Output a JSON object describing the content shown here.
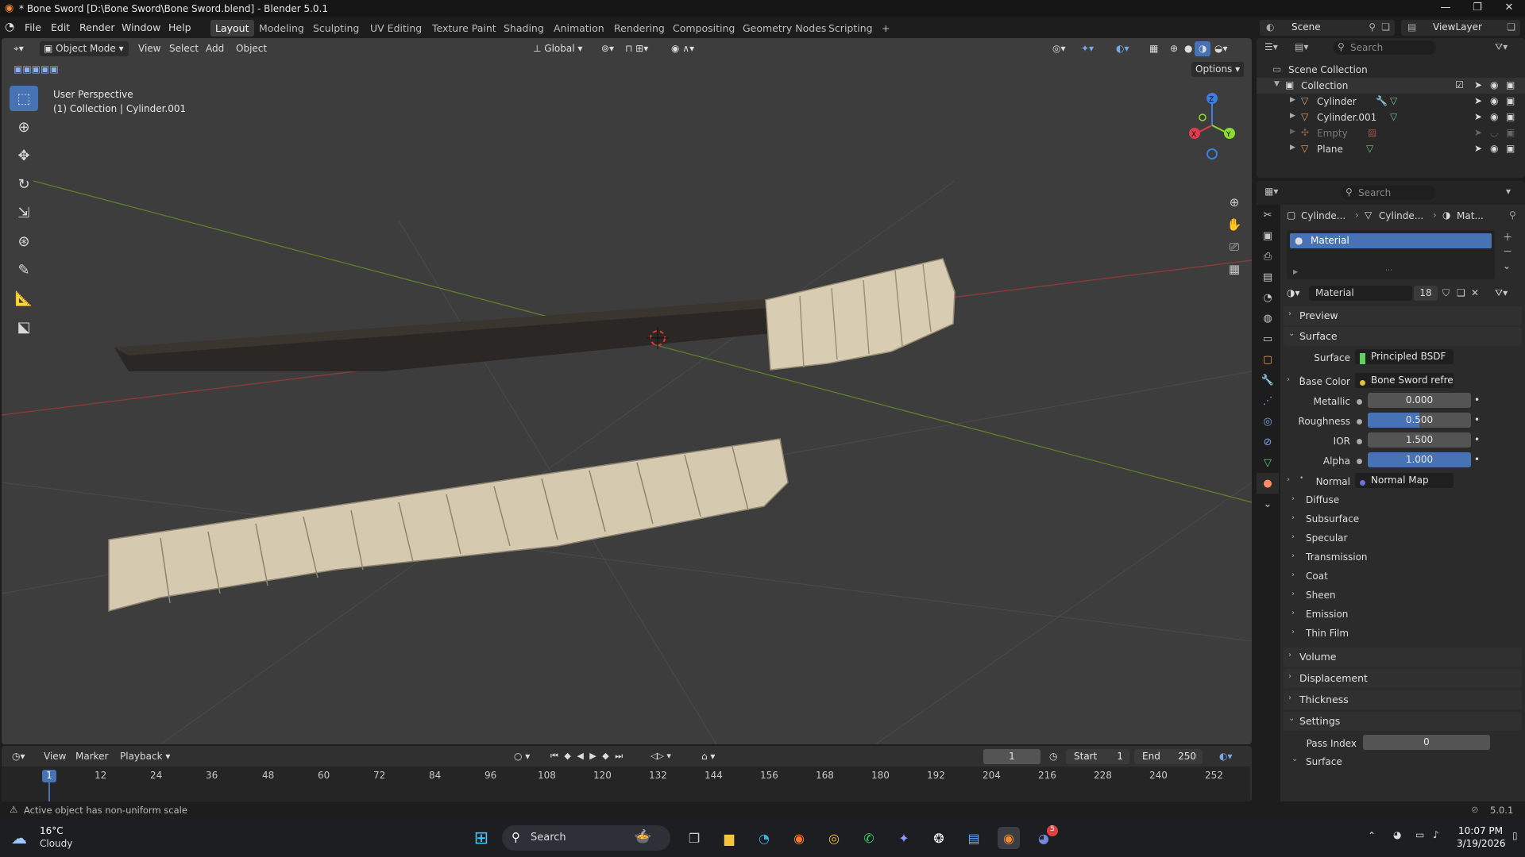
{
  "window": {
    "title": "* Bone Sword [D:\\Bone Sword\\Bone Sword.blend] - Blender 5.0.1",
    "minimize": "—",
    "maximize": "❐",
    "close": "✕"
  },
  "menubar": {
    "items": [
      "File",
      "Edit",
      "Render",
      "Window",
      "Help"
    ]
  },
  "workspaces": [
    "Layout",
    "Modeling",
    "Sculpting",
    "UV Editing",
    "Texture Paint",
    "Shading",
    "Animation",
    "Rendering",
    "Compositing",
    "Geometry Nodes",
    "Scripting"
  ],
  "active_workspace": "Layout",
  "add_workspace": "+",
  "scene": {
    "name": "Scene",
    "view_layer": "ViewLayer"
  },
  "viewport": {
    "mode": "Object Mode",
    "menus": [
      "View",
      "Select",
      "Add",
      "Object"
    ],
    "transform_orientation": "Global",
    "options_label": "Options",
    "perspective_label": "User Perspective",
    "collection_label": "(1) Collection | Cylinder.001",
    "gizmo_axes": [
      "Z",
      "Y",
      "X"
    ]
  },
  "outliner": {
    "search_placeholder": "Search",
    "root": "Scene Collection",
    "collection": "Collection",
    "objects": [
      {
        "name": "Cylinder"
      },
      {
        "name": "Cylinder.001"
      },
      {
        "name": "Empty"
      },
      {
        "name": "Plane"
      }
    ]
  },
  "properties": {
    "search_placeholder": "Search",
    "breadcrumb": [
      "Cylinde...",
      "Cylinde...",
      "Mat..."
    ],
    "material_slot": "Material",
    "material_name": "Material",
    "material_users": "18",
    "panels": {
      "preview": "Preview",
      "surface": "Surface",
      "surface_label": "Surface",
      "surface_value": "Principled BSDF",
      "base_color_label": "Base Color",
      "base_color_value": "Bone Sword refrence_...",
      "metallic_label": "Metallic",
      "metallic_value": "0.000",
      "roughness_label": "Roughness",
      "roughness_value": "0.500",
      "ior_label": "IOR",
      "ior_value": "1.500",
      "alpha_label": "Alpha",
      "alpha_value": "1.000",
      "normal_label": "Normal",
      "normal_value": "Normal Map",
      "subpanels": [
        "Diffuse",
        "Subsurface",
        "Specular",
        "Transmission",
        "Coat",
        "Sheen",
        "Emission",
        "Thin Film"
      ],
      "volume": "Volume",
      "displacement": "Displacement",
      "thickness": "Thickness",
      "settings": "Settings",
      "pass_index_label": "Pass Index",
      "pass_index_value": "0",
      "surface_sub": "Surface"
    },
    "roughness_fraction": 0.5,
    "alpha_fraction": 1.0
  },
  "timeline": {
    "menus": [
      "View",
      "Marker",
      "Playback"
    ],
    "current_frame": "1",
    "start_label": "Start",
    "start_value": "1",
    "end_label": "End",
    "end_value": "250",
    "ticks": [
      "1",
      "12",
      "24",
      "36",
      "48",
      "60",
      "72",
      "84",
      "96",
      "108",
      "120",
      "132",
      "144",
      "156",
      "168",
      "180",
      "192",
      "204",
      "216",
      "228",
      "240",
      "252"
    ]
  },
  "statusbar": {
    "message": "Active object has non-uniform scale",
    "version": "5.0.1"
  },
  "taskbar": {
    "weather_temp": "16°C",
    "weather_desc": "Cloudy",
    "search_label": "Search",
    "time": "10:07 PM",
    "date": "3/19/2026",
    "discord_badge": "5"
  },
  "colors": {
    "accent_blue": "#4772b3",
    "axis_x": "#e03c4b",
    "axis_y": "#8bdc2c",
    "axis_z": "#3d7fe0",
    "bone": "#d8cdb2",
    "blade": "#2a2724"
  }
}
